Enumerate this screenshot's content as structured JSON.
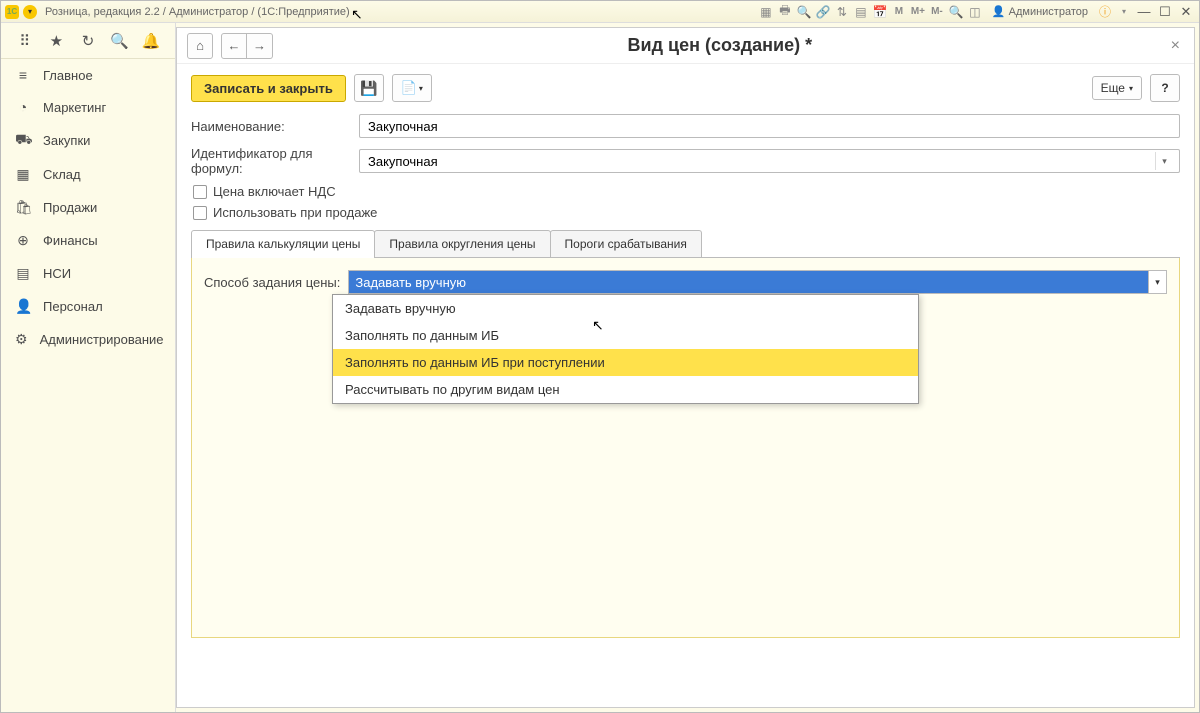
{
  "titlebar": {
    "appLogoText": "1C",
    "title": "Розница, редакция 2.2 / Администратор / (1С:Предприятие)",
    "userLabel": "Администратор",
    "mLabels": {
      "m": "М",
      "mplus": "М+",
      "mminus": "М-"
    }
  },
  "sidebar": {
    "items": [
      {
        "icon": "≡",
        "label": "Главное"
      },
      {
        "icon": "◔",
        "label": "Маркетинг"
      },
      {
        "icon": "⛟",
        "label": "Закупки"
      },
      {
        "icon": "▦",
        "label": "Склад"
      },
      {
        "icon": "🛍",
        "label": "Продажи"
      },
      {
        "icon": "⊕",
        "label": "Финансы"
      },
      {
        "icon": "▤",
        "label": "НСИ"
      },
      {
        "icon": "👤",
        "label": "Персонал"
      },
      {
        "icon": "⚙",
        "label": "Администрирование"
      }
    ]
  },
  "page": {
    "title": "Вид цен (создание) *",
    "saveClose": "Записать и закрыть",
    "moreBtn": "Еще",
    "help": "?",
    "fields": {
      "nameLabel": "Наименование:",
      "nameValue": "Закупочная",
      "idLabel": "Идентификатор для формул:",
      "idValue": "Закупочная",
      "chkVat": "Цена включает НДС",
      "chkSale": "Использовать при продаже"
    },
    "tabs": [
      "Правила калькуляции цены",
      "Правила округления цены",
      "Пороги срабатывания"
    ],
    "methodLabel": "Способ задания цены:",
    "methodValue": "Задавать вручную",
    "methodOptions": [
      "Задавать вручную",
      "Заполнять по данным ИБ",
      "Заполнять по данным ИБ при поступлении",
      "Рассчитывать по другим видам цен"
    ],
    "methodHighlightedIndex": 2
  }
}
